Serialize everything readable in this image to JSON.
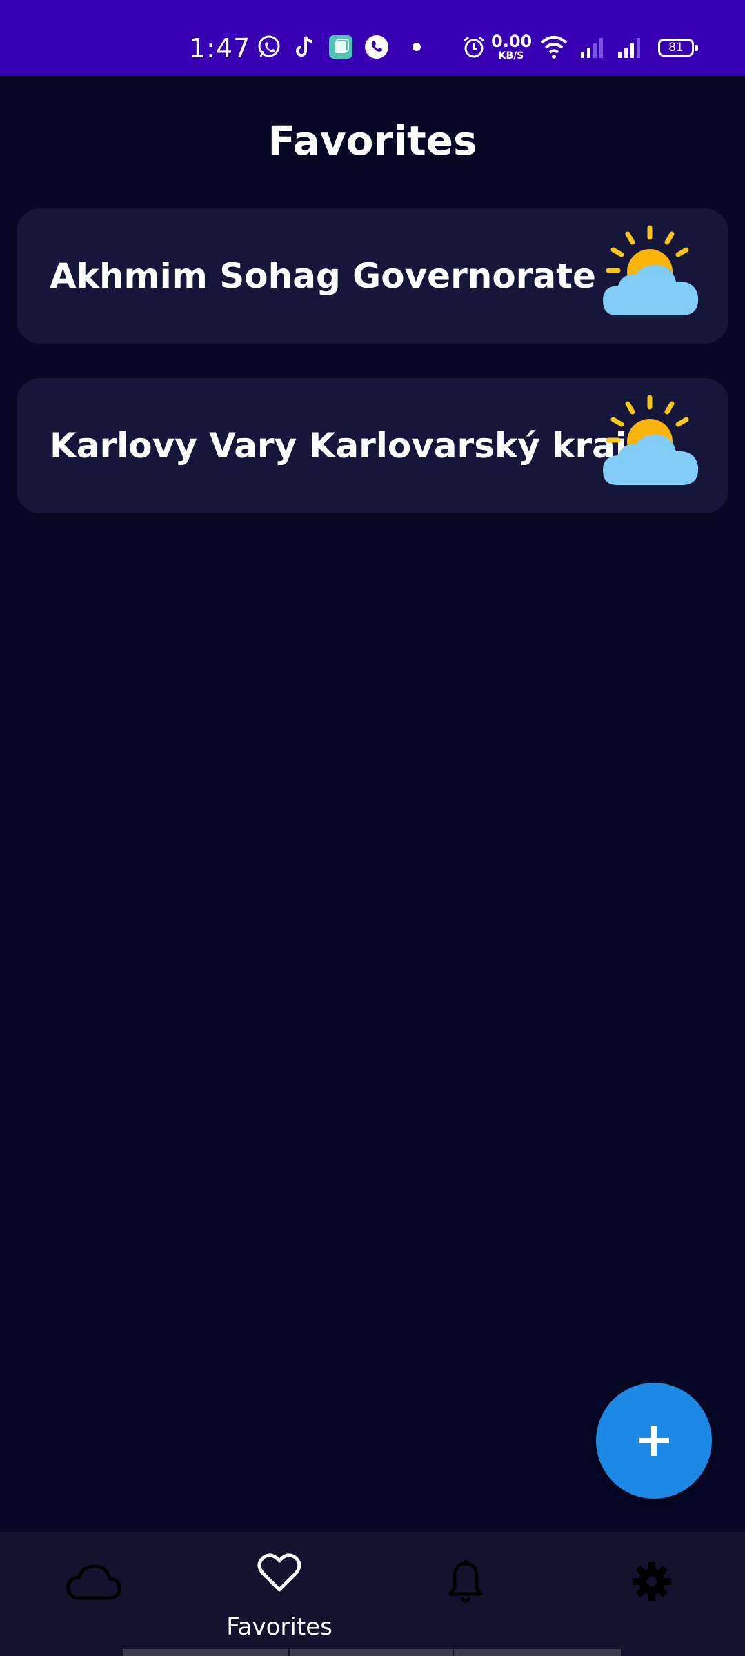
{
  "status_bar": {
    "time": "1:47",
    "net_speed_value": "0.00",
    "net_speed_unit": "KB/S",
    "battery": "81",
    "icons": [
      "whatsapp-icon",
      "tiktok-icon",
      "app-icon",
      "phone-call-icon",
      "dot-icon",
      "alarm-icon",
      "wifi-icon",
      "signal-1-icon",
      "signal-2-icon",
      "battery-icon"
    ]
  },
  "page": {
    "title": "Favorites"
  },
  "favorites": [
    {
      "city": "Akhmim Sohag Governorate",
      "icon": "partly-cloudy-icon"
    },
    {
      "city": "Karlovy Vary Karlovarský kraj",
      "icon": "partly-cloudy-icon"
    }
  ],
  "fab": {
    "icon": "plus-icon"
  },
  "bottom_nav": {
    "items": [
      {
        "name": "weather",
        "icon": "cloud-icon",
        "label": ""
      },
      {
        "name": "favorites",
        "icon": "heart-icon",
        "label": "Favorites",
        "active": true
      },
      {
        "name": "alerts",
        "icon": "bell-icon",
        "label": ""
      },
      {
        "name": "settings",
        "icon": "gear-icon",
        "label": ""
      }
    ]
  },
  "colors": {
    "status_bar": "#3700b3",
    "background": "#070825",
    "card": "#15163a",
    "fab": "#1e88e5",
    "nav": "#13132e",
    "sun": "#fbb40a",
    "cloud": "#81cdf7"
  }
}
